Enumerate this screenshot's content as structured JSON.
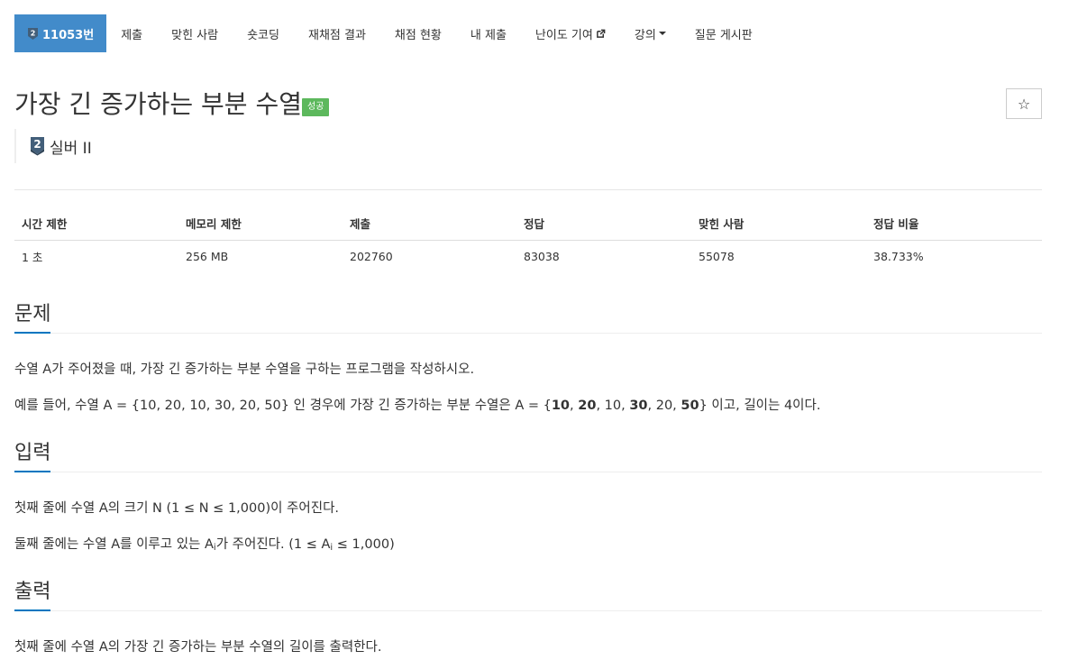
{
  "nav": {
    "problem_id": "11053번",
    "items": [
      "제출",
      "맞힌 사람",
      "숏코딩",
      "재채점 결과",
      "채점 현황",
      "내 제출",
      "난이도 기여",
      "강의",
      "질문 게시판"
    ]
  },
  "problem": {
    "title": "가장 긴 증가하는 부분 수열",
    "result_badge": "성공",
    "tier": "실버 II",
    "tier_number": "2",
    "star": "☆"
  },
  "info": {
    "headers": [
      "시간 제한",
      "메모리 제한",
      "제출",
      "정답",
      "맞힌 사람",
      "정답 비율"
    ],
    "values": [
      "1 초",
      "256 MB",
      "202760",
      "83038",
      "55078",
      "38.733%"
    ]
  },
  "sections": {
    "description": {
      "heading": "문제",
      "line1": "수열 A가 주어졌을 때, 가장 긴 증가하는 부분 수열을 구하는 프로그램을 작성하시오.",
      "line2_prefix": "예를 들어, 수열 A = {10, 20, 10, 30, 20, 50} 인 경우에 가장 긴 증가하는 부분 수열은 A = {",
      "seq": [
        "10",
        ", ",
        "20",
        ", 10, ",
        "30",
        ", 20, ",
        "50"
      ],
      "line2_suffix": "} 이고, 길이는 4이다."
    },
    "input": {
      "heading": "입력",
      "line1": "첫째 줄에 수열 A의 크기 N (1 ≤ N ≤ 1,000)이 주어진다.",
      "line2_a": "둘째 줄에는 수열 A를 이루고 있는 A",
      "line2_sub": "i",
      "line2_b": "가 주어진다. (1 ≤ A",
      "line2_sub2": "i",
      "line2_c": " ≤ 1,000)"
    },
    "output": {
      "heading": "출력",
      "line1": "첫째 줄에 수열 A의 가장 긴 증가하는 부분 수열의 길이를 출력한다."
    }
  },
  "colors": {
    "nav_active": "#428bca",
    "success_badge": "#5cb85c",
    "section_accent": "#0076c0"
  }
}
